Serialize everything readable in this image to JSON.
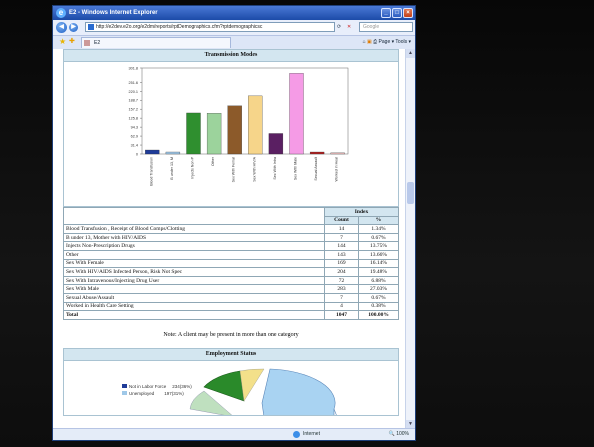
{
  "window": {
    "title": "E2 - Windows Internet Explorer",
    "address": "http://e2dev.e2o.org/e2dm/reports/rptDemographics.cfm?rptdemographicsc",
    "search_placeholder": "Google",
    "tab_title": "E2",
    "tools": "Page ▾  Tools ▾",
    "status_zone": "Internet",
    "status_zoom": "100%"
  },
  "sections": {
    "transmission_title": "Transmission Modes",
    "employment_title": "Employment Status",
    "note": "Note: A client may be present in more than one category"
  },
  "table": {
    "group_header": "Index",
    "col_count": "Count",
    "col_pct": "%",
    "rows": [
      {
        "label": "Blood Transfusion , Receipt of Blood Comps/Clotting",
        "count": "14",
        "pct": "1.34%"
      },
      {
        "label": "B under 13, Mother with HIV/AIDS",
        "count": "7",
        "pct": "0.67%"
      },
      {
        "label": "Injects Non-Prescription Drugs",
        "count": "144",
        "pct": "13.75%"
      },
      {
        "label": "Other",
        "count": "143",
        "pct": "13.66%"
      },
      {
        "label": "Sex With Female",
        "count": "169",
        "pct": "16.14%"
      },
      {
        "label": "Sex With HIV/AIDS Infected Person, Risk Not Spec",
        "count": "204",
        "pct": "19.48%"
      },
      {
        "label": "Sex With Intravenous/Injecting Drug User",
        "count": "72",
        "pct": "6.88%"
      },
      {
        "label": "Sex With Male",
        "count": "283",
        "pct": "27.03%"
      },
      {
        "label": "Sexual Abuse/Assault",
        "count": "7",
        "pct": "0.67%"
      },
      {
        "label": "Worked in Health Care Setting",
        "count": "4",
        "pct": "0.38%"
      }
    ],
    "total": {
      "label": "Total",
      "count": "1047",
      "pct": "100.00%"
    }
  },
  "chart_data": [
    {
      "type": "bar",
      "title": "Transmission Modes",
      "categories": [
        "Blood Transfusion",
        "B under 13, M",
        "Injects Non-P",
        "Other",
        "Sex With Femal",
        "Sex With HIV/A",
        "Sex With Intra",
        "Sex With Male",
        "Sexual Assault",
        "Worked in Heal"
      ],
      "values": [
        14,
        7,
        144,
        143,
        169,
        204,
        72,
        283,
        7,
        4
      ],
      "colors": [
        "#1f3c99",
        "#9fc8e8",
        "#2f8f2f",
        "#9cd39c",
        "#8c5a2a",
        "#f6d58a",
        "#5a1f62",
        "#f59be6",
        "#b02020",
        "#f4c0c0"
      ],
      "ylim": [
        0,
        301.8
      ],
      "yticks": [
        "0",
        "31.4",
        "62.9",
        "94.3",
        "125.8",
        "157.2",
        "188.7",
        "220.1",
        "251.6",
        "301.8"
      ],
      "xlabel": "",
      "ylabel": ""
    },
    {
      "type": "pie",
      "title": "Employment Status",
      "legend": [
        {
          "label": "Not in Labor Force",
          "value": "234(36%)",
          "color": "#1f3c99"
        },
        {
          "label": "Unemployed",
          "value": "197(31%)",
          "color": "#9fc8e8"
        }
      ]
    }
  ]
}
